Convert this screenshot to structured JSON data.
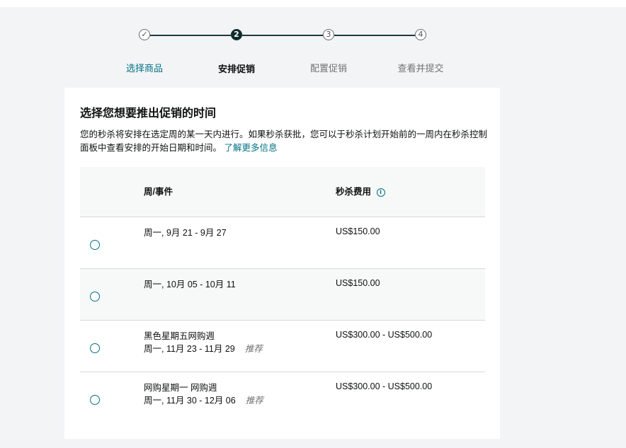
{
  "stepper": {
    "steps": [
      {
        "number": "✓",
        "label": "选择商品"
      },
      {
        "number": "2",
        "label": "安排促销"
      },
      {
        "number": "3",
        "label": "配置促销"
      },
      {
        "number": "4",
        "label": "查看并提交"
      }
    ]
  },
  "card": {
    "title": "选择您想要推出促销的时间",
    "description": "您的秒杀将安排在选定周的某一天内进行。如果秒杀获批，您可以于秒杀计划开始前的一周内在秒杀控制面板中查看安排的开始日期和时间。",
    "learn_more": "了解更多信息"
  },
  "table": {
    "headers": {
      "event": "周/事件",
      "fee": "秒杀费用",
      "info_icon": "ⓘ"
    },
    "rows": [
      {
        "event_name": "",
        "dates": "周一, 9月 21 - 9月 27",
        "tag": "",
        "fee": "US$150.00"
      },
      {
        "event_name": "",
        "dates": "周一, 10月 05 - 10月 11",
        "tag": "",
        "fee": "US$150.00"
      },
      {
        "event_name": "黑色星期五网购週",
        "dates": "周一, 11月 23 - 11月 29",
        "tag": "推荐",
        "fee": "US$300.00 - US$500.00"
      },
      {
        "event_name": "网购星期一 网购週",
        "dates": "周一, 11月 30 - 12月 06",
        "tag": "推荐",
        "fee": "US$300.00 - US$500.00"
      }
    ]
  }
}
